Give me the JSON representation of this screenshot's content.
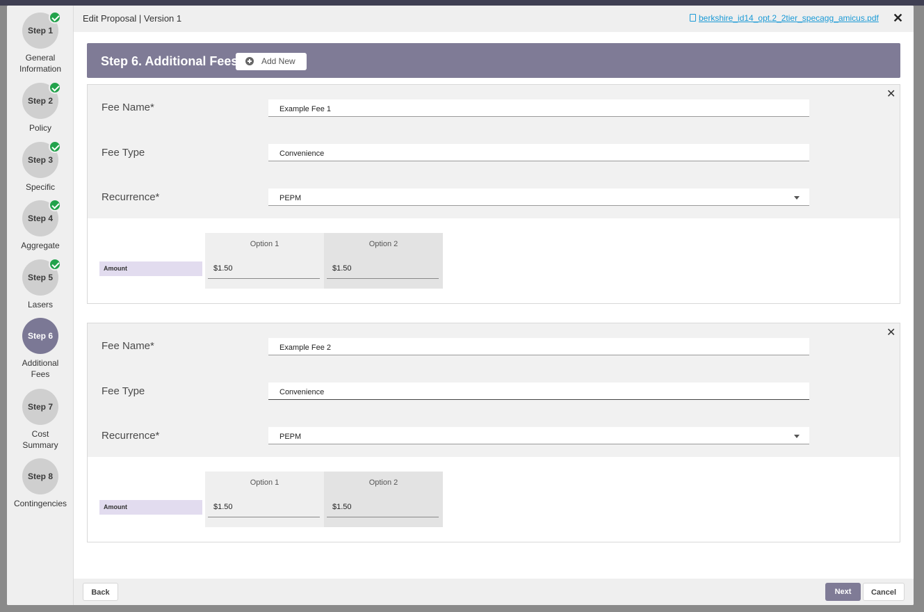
{
  "modal": {
    "title": "Edit Proposal | Version 1",
    "pdf_link": "berkshire_id14_opt.2_2tier_specagg_amicus.pdf",
    "close_glyph": "✕"
  },
  "stepper": [
    {
      "label": "Step 1",
      "name": "General Information",
      "completed": true,
      "active": false
    },
    {
      "label": "Step 2",
      "name": "Policy",
      "completed": true,
      "active": false
    },
    {
      "label": "Step 3",
      "name": "Specific",
      "completed": true,
      "active": false
    },
    {
      "label": "Step 4",
      "name": "Aggregate",
      "completed": true,
      "active": false
    },
    {
      "label": "Step 5",
      "name": "Lasers",
      "completed": true,
      "active": false
    },
    {
      "label": "Step 6",
      "name": "Additional Fees",
      "completed": false,
      "active": true
    },
    {
      "label": "Step 7",
      "name": "Cost Summary",
      "completed": false,
      "active": false
    },
    {
      "label": "Step 8",
      "name": "Contingencies",
      "completed": false,
      "active": false
    }
  ],
  "section": {
    "title": "Step 6. Additional Fees",
    "add_new_label": "Add New"
  },
  "fees": [
    {
      "fee_name_label": "Fee Name*",
      "fee_name": "Example Fee 1",
      "fee_type_label": "Fee Type",
      "fee_type": "Convenience",
      "recurrence_label": "Recurrence*",
      "recurrence": "PEPM",
      "amount_label": "Amount",
      "options": [
        {
          "title": "Option 1",
          "value": "$1.50"
        },
        {
          "title": "Option 2",
          "value": "$1.50"
        }
      ]
    },
    {
      "fee_name_label": "Fee Name*",
      "fee_name": "Example Fee 2",
      "fee_type_label": "Fee Type",
      "fee_type": "Convenience",
      "recurrence_label": "Recurrence*",
      "recurrence": "PEPM",
      "amount_label": "Amount",
      "options": [
        {
          "title": "Option 1",
          "value": "$1.50"
        },
        {
          "title": "Option 2",
          "value": "$1.50"
        }
      ]
    }
  ],
  "footer": {
    "back_label": "Back",
    "next_label": "Next",
    "cancel_label": "Cancel"
  },
  "colors": {
    "accent": "#7f7b96",
    "step_complete": "#22a24b",
    "link": "#1a9ad6",
    "amount_label_bg": "#e2dcef"
  },
  "icons": [
    "check-icon",
    "pdf-file-icon",
    "close-icon",
    "plus-circle-icon",
    "chevron-down-icon"
  ]
}
